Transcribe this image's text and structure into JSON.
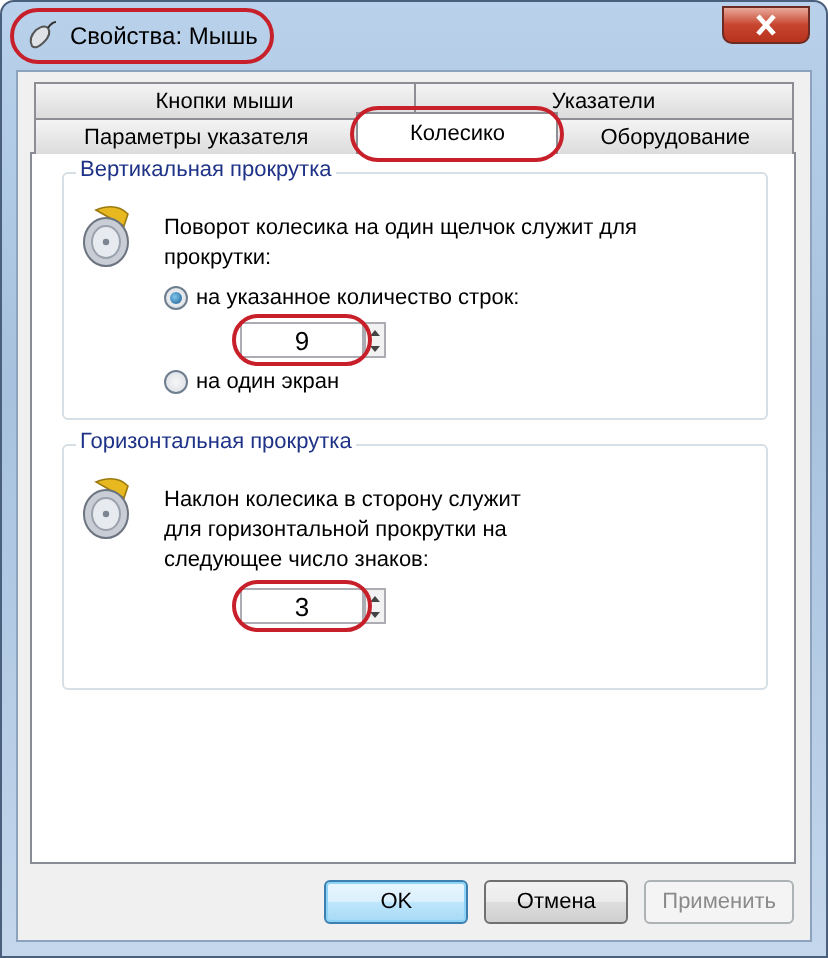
{
  "window": {
    "title": "Свойства: Мышь",
    "highlighted": true
  },
  "tab_rows": [
    {
      "tabs": [
        {
          "label": "Кнопки мыши",
          "selected": false,
          "highlighted": false
        },
        {
          "label": "Указатели",
          "selected": false,
          "highlighted": false
        }
      ]
    },
    {
      "tabs": [
        {
          "label": "Параметры указателя",
          "selected": false,
          "highlighted": false
        },
        {
          "label": "Колесико",
          "selected": true,
          "highlighted": true
        },
        {
          "label": "Оборудование",
          "selected": false,
          "highlighted": false
        }
      ]
    }
  ],
  "groups": [
    {
      "title": "Вертикальная прокрутка",
      "description": "Поворот колесика на один щелчок служит для прокрутки:",
      "options": [
        {
          "kind": "radio",
          "label": "на указанное количество строк:",
          "selected": true
        },
        {
          "kind": "spin",
          "value": "9",
          "highlighted": true
        },
        {
          "kind": "radio",
          "label": "на один экран",
          "selected": false
        }
      ]
    },
    {
      "title": "Горизонтальная прокрутка",
      "description": "Наклон колесика в сторону служит для горизонтальной прокрутки на следующее число знаков:",
      "options": [
        {
          "kind": "spin",
          "value": "3",
          "highlighted": true
        }
      ]
    }
  ],
  "buttons": [
    {
      "label": "OK",
      "default": true,
      "disabled": false
    },
    {
      "label": "Отмена",
      "default": false,
      "disabled": false
    },
    {
      "label": "Применить",
      "default": false,
      "disabled": true
    }
  ]
}
